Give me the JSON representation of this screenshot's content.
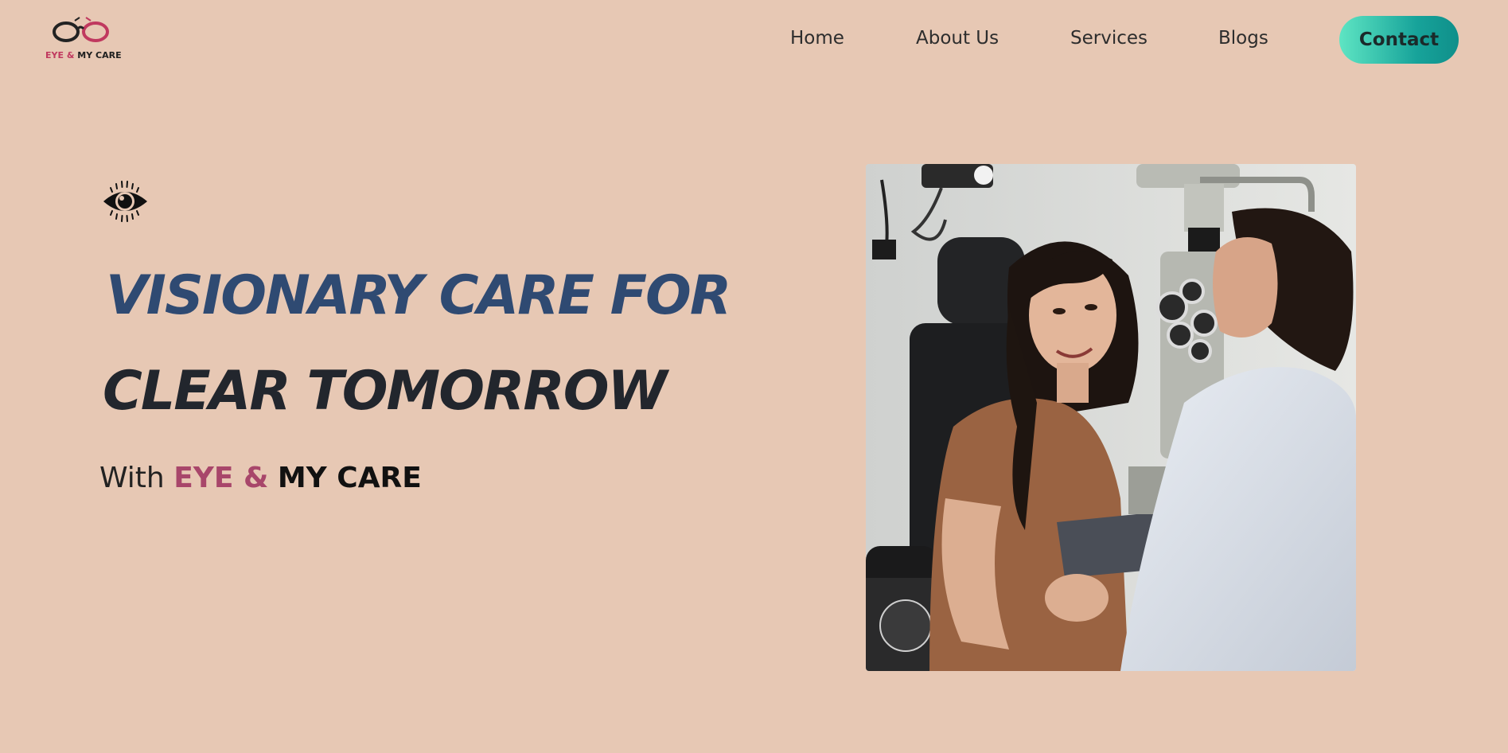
{
  "header": {
    "logo": {
      "text_pink": "EYE &",
      "text_dark": "MY CARE",
      "icon": "glasses-icon"
    },
    "nav": [
      {
        "label": "Home"
      },
      {
        "label": "About Us"
      },
      {
        "label": "Services"
      },
      {
        "label": "Blogs"
      }
    ],
    "contact_label": "Contact"
  },
  "hero": {
    "icon": "eye-icon",
    "headline_line1": "VISIONARY CARE FOR",
    "headline_line2": "CLEAR TOMORROW",
    "tagline_with": "With",
    "tagline_brand_pink": "EYE &",
    "tagline_brand_dark": "MY CARE",
    "image_icon": "eye-exam-photo"
  },
  "colors": {
    "background": "#e7c8b4",
    "brand_pink": "#c0395f",
    "headline_blue": "#2f4a72",
    "headline_dark": "#22262d",
    "contact_gradient_start": "#5ee5c3",
    "contact_gradient_end": "#0f8f8a"
  }
}
